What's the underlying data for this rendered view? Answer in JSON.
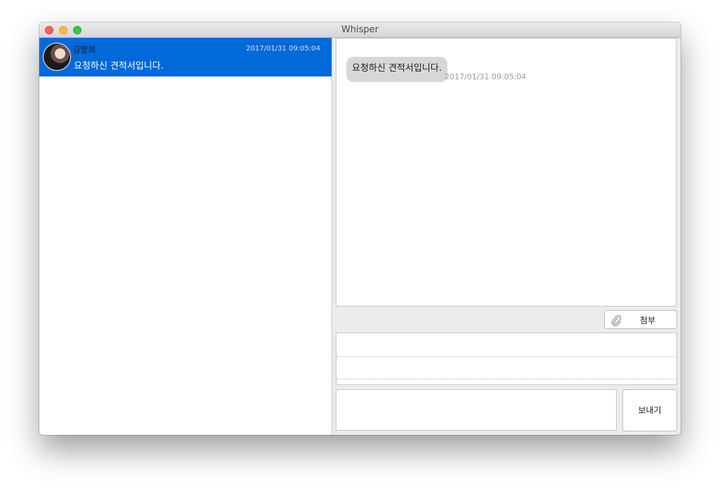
{
  "window": {
    "title": "Whisper"
  },
  "sidebar": {
    "conversations": [
      {
        "name": "김영희",
        "timestamp": "2017/01/31 09:05:04",
        "preview": "요청하신 견적서입니다."
      }
    ]
  },
  "chat": {
    "messages": [
      {
        "text": "요청하신 견적서입니다.",
        "timestamp": "2017/01/31 09:05:04"
      }
    ]
  },
  "toolbar": {
    "attach_label": "첨부"
  },
  "composer": {
    "message_value": "",
    "send_label": "보내기"
  },
  "colors": {
    "selection": "#0269d9",
    "bubble": "#d7d7d7",
    "window_bg": "#ececec"
  }
}
